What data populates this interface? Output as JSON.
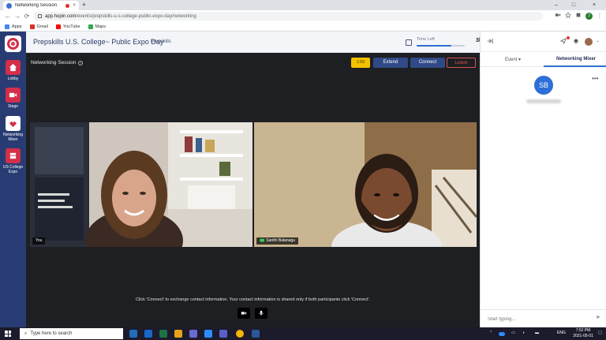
{
  "browser": {
    "tab_title": "Networking Session",
    "tab_close": "×",
    "new_tab": "+",
    "url_domain": "app.hopin.com",
    "url_path": "/events/prepskills-u-s-college-public-expo-day/networking",
    "profile_initial": "J",
    "window_controls": [
      "–",
      "□",
      "×"
    ],
    "nav": [
      "←",
      "→",
      "⟳"
    ],
    "bookmarks": [
      {
        "label": "Apps",
        "color": "#4285f4"
      },
      {
        "label": "Gmail",
        "color": "#d93025"
      },
      {
        "label": "YouTube",
        "color": "#ff0000"
      },
      {
        "label": "Maps",
        "color": "#34a853"
      }
    ]
  },
  "sidebar": {
    "items": [
      {
        "label": "Lobby",
        "icon": "home-icon"
      },
      {
        "label": "Stage",
        "icon": "stage-icon"
      },
      {
        "label": "Networking Mixer",
        "icon": "networking-icon"
      },
      {
        "label": "US College Expo",
        "icon": "expo-icon"
      }
    ]
  },
  "event": {
    "title": "Prepskills U.S. College~ Public Expo Day",
    "subtitle": "Prepskills",
    "time_left_label": "Time Left",
    "time_left_value": "3h:8m",
    "time_left_fraction": 0.72
  },
  "session": {
    "title": "Networking Session",
    "timer_label": "1:59",
    "extend_label": "Extend",
    "connect_label": "Connect",
    "leave_label": "Leave",
    "participants": [
      {
        "name": "You"
      },
      {
        "name": "Santhi Balanagu"
      }
    ],
    "hint": "Click 'Connect' to exchange contact information. Your contact information is shared only if both participants click 'Connect'."
  },
  "right_panel": {
    "tabs": [
      {
        "label": "Event ▾"
      },
      {
        "label": "Networking Mixer"
      }
    ],
    "participant_initials": "SB",
    "more": "•••",
    "chat_placeholder": "Start typing...",
    "send": "➤"
  },
  "taskbar": {
    "search_placeholder": "Type here to search",
    "language": "ENG",
    "time": "7:52 PM",
    "date": "2021-05-01"
  }
}
